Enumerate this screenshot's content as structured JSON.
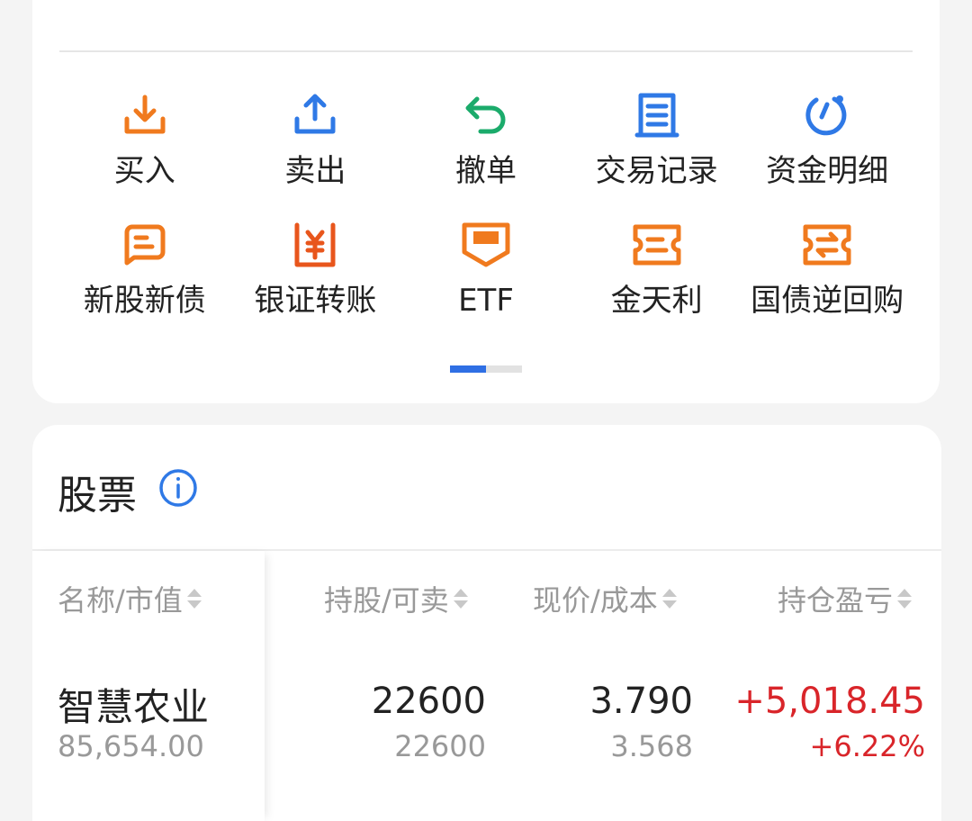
{
  "quick_actions": [
    {
      "label": "买入",
      "icon": "download-icon",
      "color": "#f07a1e"
    },
    {
      "label": "卖出",
      "icon": "upload-icon",
      "color": "#2f79e6"
    },
    {
      "label": "撤单",
      "icon": "undo-arrow-icon",
      "color": "#1bab6b"
    },
    {
      "label": "交易记录",
      "icon": "document-list-icon",
      "color": "#2f79e6"
    },
    {
      "label": "资金明细",
      "icon": "refresh-circle-icon",
      "color": "#2f79e6"
    },
    {
      "label": "新股新债",
      "icon": "chat-card-icon",
      "color": "#f07a1e"
    },
    {
      "label": "银证转账",
      "icon": "yen-transfer-icon",
      "color": "#e8561c"
    },
    {
      "label": "ETF",
      "icon": "etf-badge-icon",
      "color": "#f07a1e"
    },
    {
      "label": "金天利",
      "icon": "ticket-icon",
      "color": "#f07a1e"
    },
    {
      "label": "国债逆回购",
      "icon": "exchange-ticket-icon",
      "color": "#f07a1e"
    }
  ],
  "pager": {
    "pages": 2,
    "active": 1
  },
  "stocks": {
    "title": "股票",
    "headers": [
      "名称/市值",
      "持股/可卖",
      "现价/成本",
      "持仓盈亏"
    ],
    "rows": [
      {
        "name": "智慧农业",
        "market_value": "85,654.00",
        "shares": "22600",
        "sellable": "22600",
        "price": "3.790",
        "cost": "3.568",
        "pnl": "+5,018.45",
        "pnl_pct": "+6.22%"
      }
    ]
  },
  "colors": {
    "accent": "#2f6fe4",
    "profit": "#d9252a"
  }
}
